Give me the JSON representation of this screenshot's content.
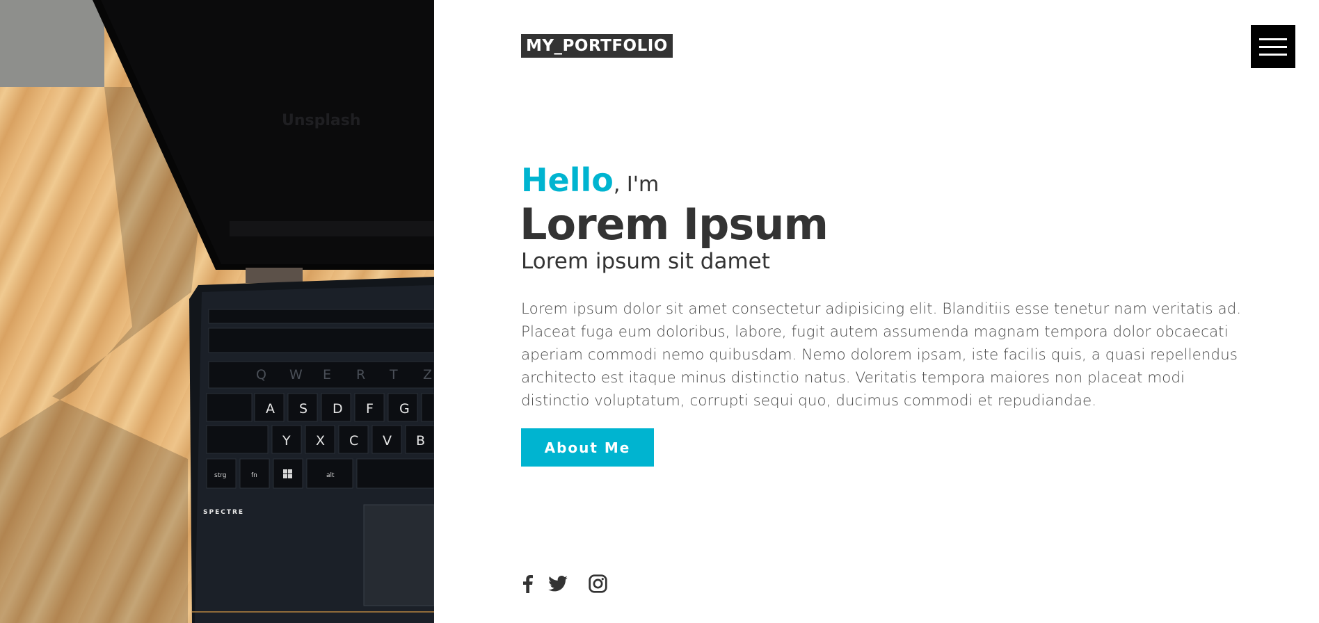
{
  "header": {
    "logo": "MY_PORTFOLIO",
    "menu_icon": "hamburger-menu-icon"
  },
  "hero": {
    "hello": "Hello",
    "im": ", I'm",
    "name": "Lorem Ipsum",
    "subtitle": "Lorem ipsum sit damet",
    "bio": "Lorem ipsum dolor sit amet consectetur adipisicing elit. Blanditiis esse tenetur nam veritatis ad. Placeat fuga eum doloribus, labore, fugit autem assumenda magnam tempora dolor obcaecati aperiam commodi nemo quibusdam. Nemo dolorem ipsam, iste facilis quis, a quasi repellendus architecto est itaque minus distinctio natus. Veritatis tempora maiores non placeat modi distinctio voluptatum, corrupti sequi quo, ducimus commodi et repudiandae.",
    "button_label": "About Me"
  },
  "socials": [
    {
      "icon": "facebook-icon"
    },
    {
      "icon": "twitter-icon"
    },
    {
      "icon": "instagram-icon"
    }
  ],
  "colors": {
    "accent": "#00b4d0",
    "text": "#333333",
    "logo_bg": "#333333",
    "menu_bg": "#000000"
  },
  "image": {
    "laptop_text": "Unsplash",
    "brand_text": "SPECTRE",
    "keys": [
      "A",
      "S",
      "D",
      "F",
      "G",
      "Y",
      "X",
      "C",
      "V",
      "B",
      "Q",
      "W",
      "E",
      "R",
      "T",
      "Z",
      "strg",
      "fn",
      "alt"
    ]
  }
}
